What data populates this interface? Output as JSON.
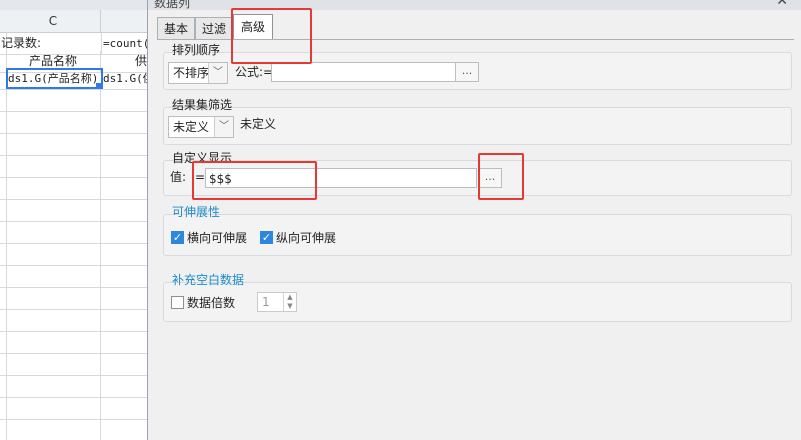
{
  "sheet": {
    "column_c": "C",
    "row1_c": "记录数:",
    "row1_d": "=count(",
    "row2_c": "产品名称",
    "row2_d": "供",
    "row3_c": "ds1.G(产品名称)",
    "row3_d": "ds1.G(供"
  },
  "dialog": {
    "title": "数据列",
    "close": "✕",
    "tabs": [
      {
        "label": "基本",
        "active": false
      },
      {
        "label": "过滤",
        "active": false
      },
      {
        "label": "高级",
        "active": true
      }
    ],
    "sort": {
      "group_title": "排列顺序",
      "order_value": "不排序",
      "formula_label": "公式:=",
      "formula_value": "",
      "dots": "..."
    },
    "result_filter": {
      "group_title": "结果集筛选",
      "combo_value": "未定义",
      "description": "未定义"
    },
    "custom_display": {
      "group_title": "自定义显示",
      "value_label": "值:",
      "eq": "=",
      "value": "$$$",
      "dots": "..."
    },
    "extensibility": {
      "group_title": "可伸展性",
      "horizontal_label": "横向可伸展",
      "horizontal_checked": true,
      "vertical_label": "纵向可伸展",
      "vertical_checked": true
    },
    "fill_blank": {
      "group_title": "补充空白数据",
      "multiple_label": "数据倍数",
      "multiple_checked": false,
      "multiple_value": "1"
    }
  },
  "colors": {
    "accent_blue": "#2e86de",
    "group_title_blue": "#1c8bc7",
    "highlight_red": "#e53935",
    "selection_blue": "#2f7ae5"
  }
}
